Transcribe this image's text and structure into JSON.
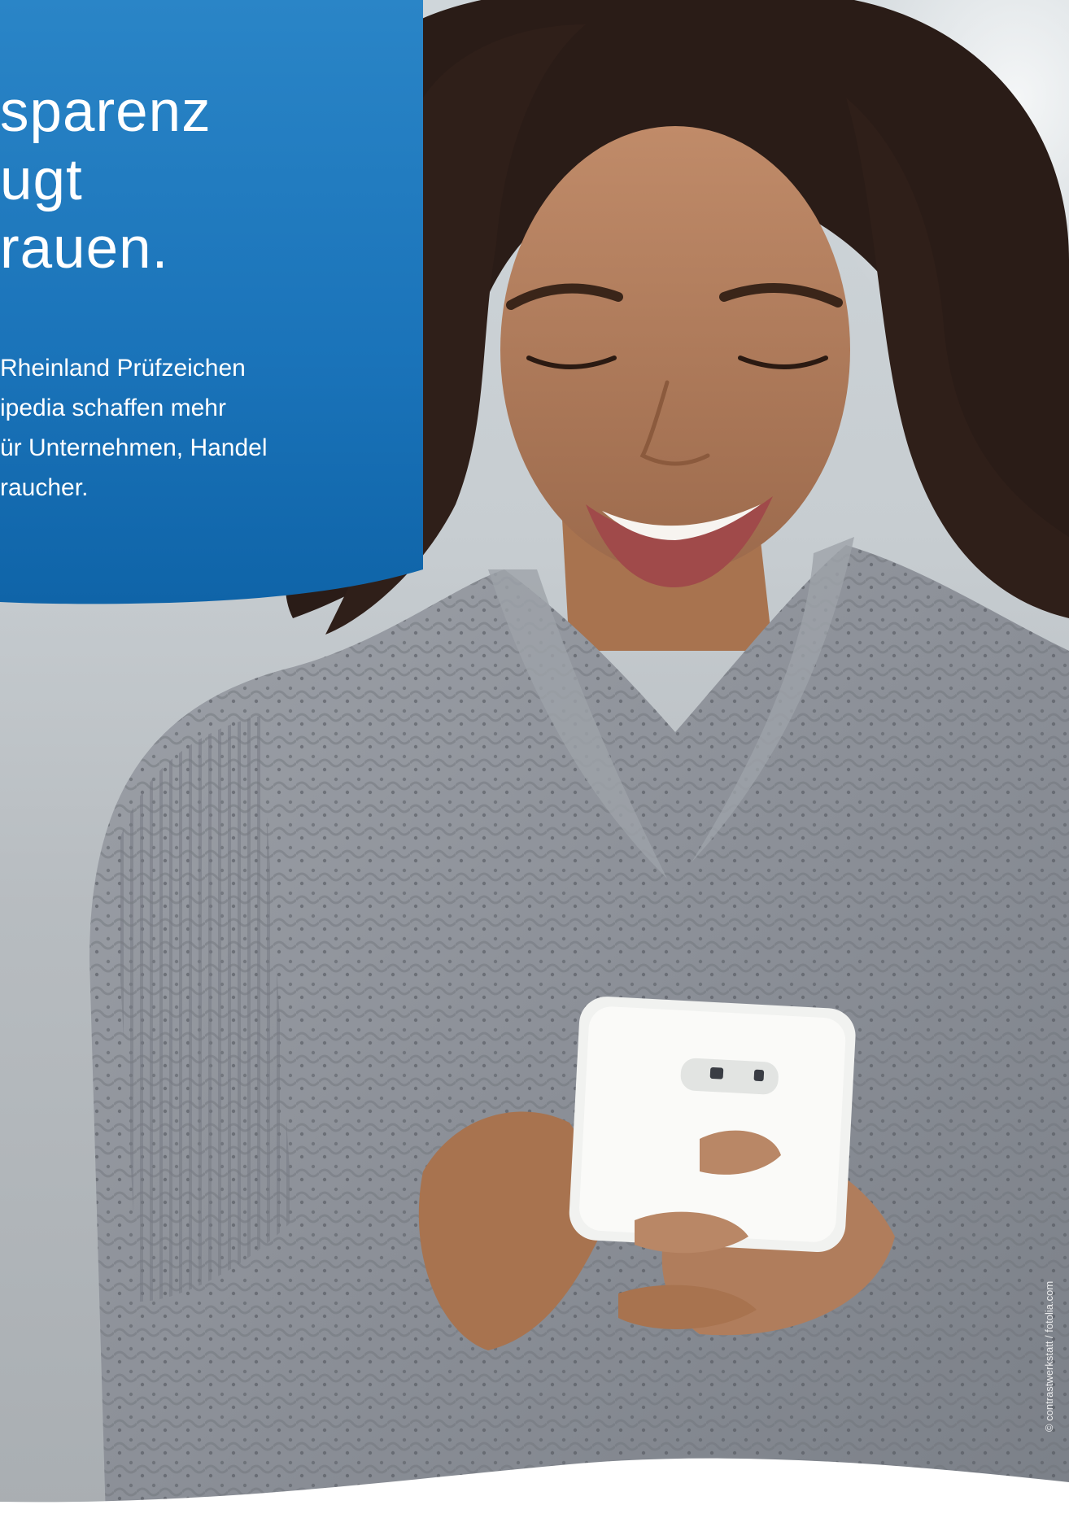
{
  "headline": {
    "line1": "sparenz",
    "line2": "ugt",
    "line3": "rauen."
  },
  "body": {
    "line1": "Rheinland Prüfzeichen",
    "line2": "ipedia schaffen mehr",
    "line3": "ür Unternehmen, Handel",
    "line4": "raucher."
  },
  "photo": {
    "description_icon": "woman-smiling-at-smartphone-photo"
  },
  "credit": "© contrastwerkstatt / fotolia.com",
  "colors": {
    "panel_blue": "#1a73b9",
    "panel_blue_dark": "#0f5fa3",
    "text": "#ffffff",
    "sweater": "#8d9198",
    "skin": "#b07d5c",
    "hair": "#2a1c17"
  }
}
